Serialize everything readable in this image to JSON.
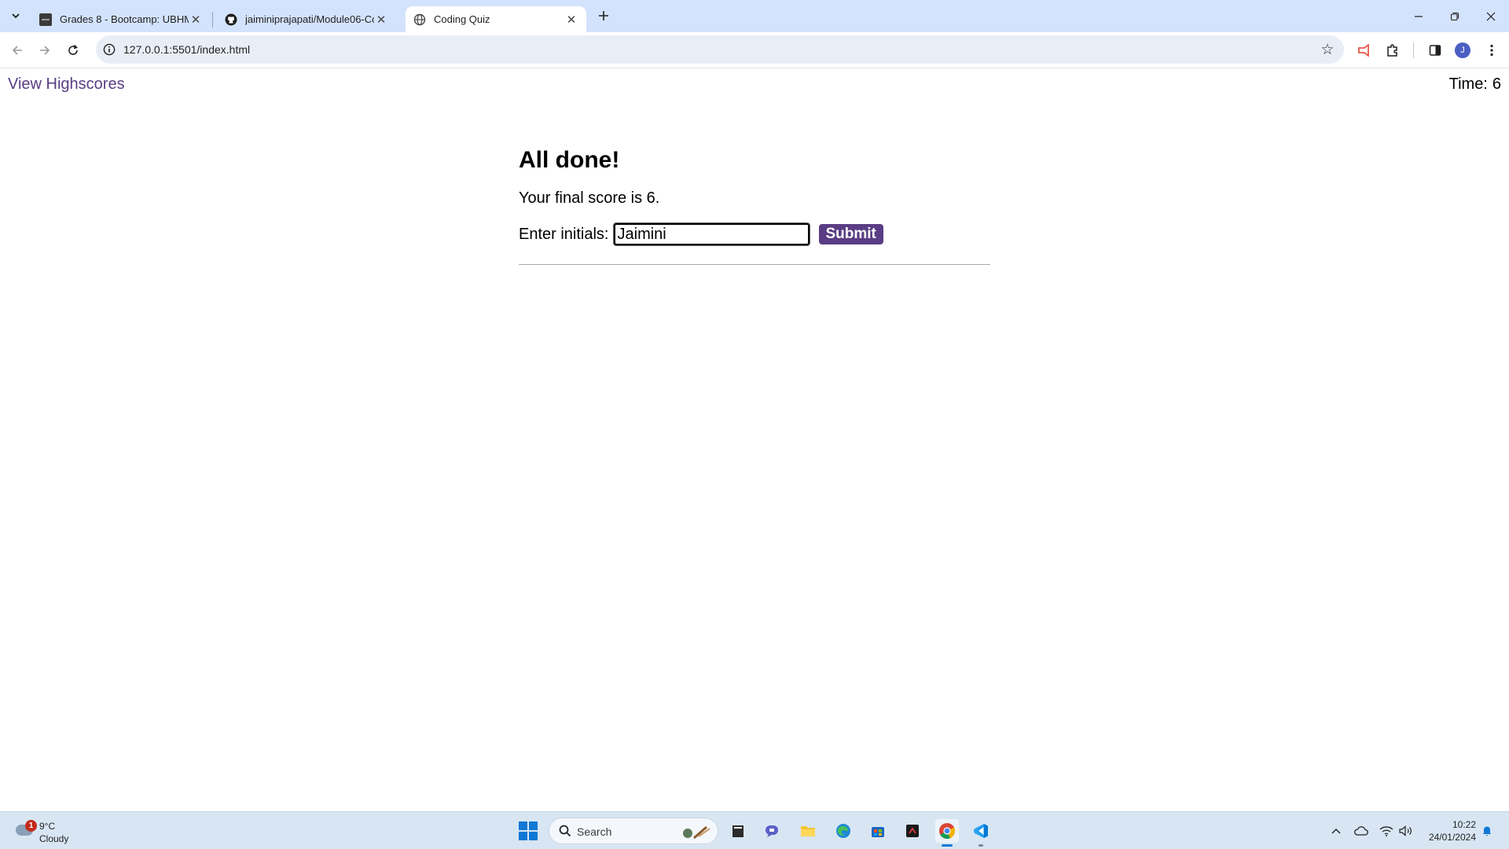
{
  "browser": {
    "tabs": [
      {
        "title": "Grades 8 - Bootcamp: UBHM-V",
        "icon": "dark-square-favicon",
        "active": false
      },
      {
        "title": "jaiminiprajapati/Module06-Cod",
        "icon": "github-icon",
        "active": false
      },
      {
        "title": "Coding Quiz",
        "icon": "globe-icon",
        "active": true
      }
    ],
    "url": "127.0.0.1:5501/index.html",
    "profile_initial": "J"
  },
  "page": {
    "view_highscores": "View Highscores",
    "timer_label": "Time:",
    "timer_value": "6",
    "heading": "All done!",
    "final_score_text": "Your final score is 6.",
    "initials_label": "Enter initials:",
    "initials_value": "Jaimini",
    "submit_label": "Submit"
  },
  "taskbar": {
    "weather": {
      "badge": "1",
      "temp": "9°C",
      "condition": "Cloudy"
    },
    "search_placeholder": "Search",
    "clock": {
      "time": "10:22",
      "date": "24/01/2024"
    }
  },
  "colors": {
    "accent_purple": "#5a3d84",
    "tabstrip": "#d3e3fd",
    "taskbar": "#d8e6f4"
  }
}
